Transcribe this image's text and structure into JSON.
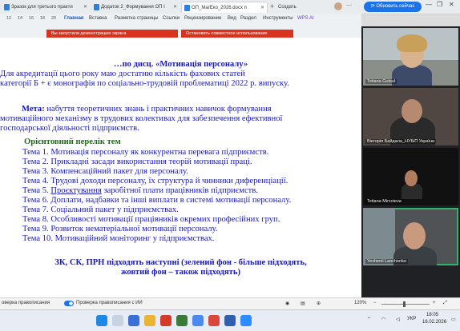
{
  "browser": {
    "tabs": [
      {
        "label": "Зразок для третього практи"
      },
      {
        "label": "Додаток 2_Формування ОП І"
      },
      {
        "label": "ОП_МагЕко_2026.docx п"
      }
    ],
    "new_tab": "+",
    "create_label": "Создать",
    "update_label": "Обновить сейчас",
    "window_controls": [
      "—",
      "❐",
      "✕"
    ]
  },
  "ribbon": {
    "numbers": [
      "12",
      "14",
      "16",
      "18",
      "20"
    ],
    "tabs": [
      "Главная",
      "Вставка",
      "Разметка страницы",
      "Ссылки",
      "Рецензирование",
      "Вид",
      "Раздел",
      "Инструменты",
      "WPS AI"
    ],
    "demo_label": "Вы запустили демонстрацию экрана",
    "stop_label": "Остановить совместное использование"
  },
  "document": {
    "l1": "…по дисц. «Мотивація персоналу»",
    "l2": "Для акредитації цього року маю достатню кількість фахових статей",
    "l3": "категорії Б + є монографія по соціально-трудовій проблематиці 2022 р. випуску.",
    "meta_label": "Мета:",
    "meta_text": " набуття теоретичних знань і практичних навичок формування",
    "l5": "мотиваційного механізму в трудових колективах для забезпечення ефективної",
    "l6": "господарської діяльності підприємств.",
    "topics_heading": "Орієнтовний перелік тем",
    "topics": [
      "Тема 1. Мотивація персоналу як конкурентна перевага підприємств.",
      "Тема 2. Прикладні засади використання теорій мотивації праці.",
      "Тема 3. Компенсаційний пакет для персоналу.",
      "Тема 4. Трудові доходи персоналу, їх структура й чинники диференціації.",
      "Тема 6. Доплати, надбавки та інші виплати в системі мотивації персоналу.",
      "Тема 7. Соціальний пакет у підприємствах.",
      "Тема 8. Особливості мотивації працівників окремих професійних груп.",
      "Тема 9. Розвиток нематеріальної мотивації персоналу.",
      "Тема 10. Мотиваційний моніторинг у підприємствах."
    ],
    "topic5_prefix": "Тема 5. ",
    "topic5_link": "Проєктування",
    "topic5_rest": " заробітної плати працівників підприємств.",
    "footer1": "ЗК, СК, ПРН підходять наступні (зелений фон - більше підходять,",
    "footer2": "жовтий фон – також підходять)"
  },
  "participants": [
    {
      "name": "Tetiana Gutsul"
    },
    {
      "name": "Вікторія Байдала_НУБіП України"
    },
    {
      "name": "Tetiana Mirzoieva"
    },
    {
      "name": "Yevhenii Lanchenko"
    }
  ],
  "statusbar": {
    "left": "оверка правописания",
    "spell": "Проверка правописания с ИИ",
    "zoom": "120%"
  },
  "taskbar": {
    "lang": "УКР",
    "time": "18:05",
    "date": "16.02.2026"
  }
}
